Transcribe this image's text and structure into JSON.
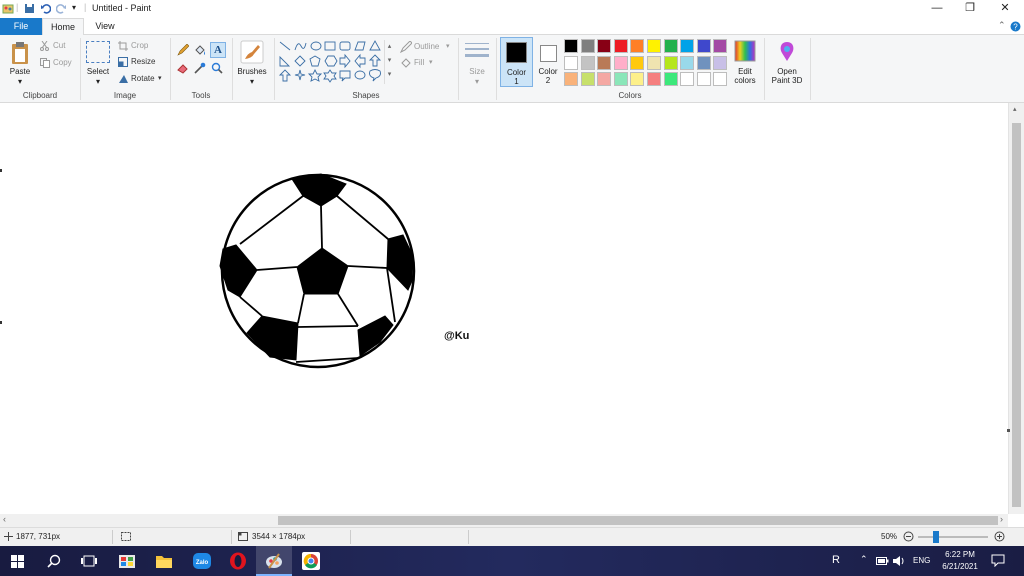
{
  "window": {
    "title": "Untitled - Paint",
    "min": "—",
    "max": "❐",
    "close": "✕"
  },
  "tabs": {
    "file": "File",
    "home": "Home",
    "view": "View"
  },
  "clipboard": {
    "paste": "Paste",
    "cut": "Cut",
    "copy": "Copy",
    "label": "Clipboard"
  },
  "image": {
    "select": "Select",
    "crop": "Crop",
    "resize": "Resize",
    "rotate": "Rotate",
    "label": "Image"
  },
  "tools": {
    "label": "Tools"
  },
  "brushes": {
    "label": "Brushes"
  },
  "shapes": {
    "outline": "Outline",
    "fill": "Fill",
    "label": "Shapes"
  },
  "size": {
    "label": "Size"
  },
  "colors": {
    "color1": "Color\n1",
    "color1_a": "Color",
    "color1_b": "1",
    "color2_a": "Color",
    "color2_b": "2",
    "edit_a": "Edit",
    "edit_b": "colors",
    "label": "Colors",
    "primary": "#000000",
    "secondary": "#ffffff",
    "row1": [
      "#000000",
      "#7f7f7f",
      "#880015",
      "#ed1c24",
      "#ff7f27",
      "#fff200",
      "#22b14c",
      "#00a2e8",
      "#3f48cc",
      "#a349a4"
    ],
    "row2": [
      "#ffffff",
      "#c3c3c3",
      "#b97a57",
      "#ffaec9",
      "#ffc90e",
      "#efe4b0",
      "#b5e61d",
      "#99d9ea",
      "#7092be",
      "#c8bfe7"
    ],
    "row3": [
      "#f9b27a",
      "#c7e06b",
      "#f4a8a3",
      "#8ae6b9",
      "#fdf08a",
      "#f57f7f",
      "#3ce87b",
      "#ffffff",
      "#ffffff",
      "#ffffff"
    ]
  },
  "paint3d": {
    "a": "Open",
    "b": "Paint 3D"
  },
  "canvas": {
    "signature": "@Ku"
  },
  "status": {
    "cursor": "1877, 731px",
    "dimensions": "3544 × 1784px",
    "zoom": "50%",
    "zoom_fraction": 0.25
  },
  "taskbar": {
    "lang": "ENG",
    "time": "6:22 PM",
    "date": "6/21/2021",
    "rx": "R"
  }
}
